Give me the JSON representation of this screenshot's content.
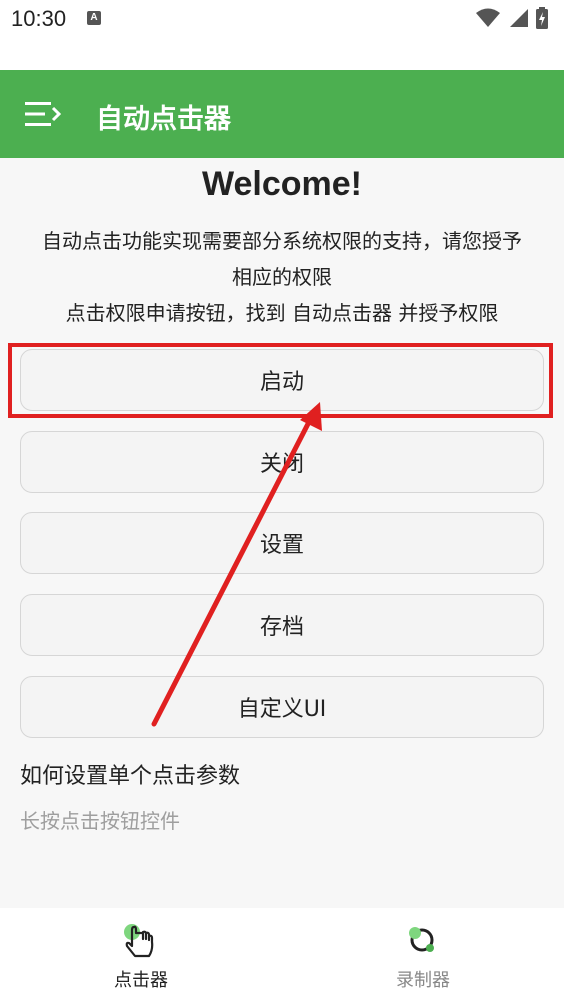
{
  "status_bar": {
    "time": "10:30",
    "notification_icon": "A"
  },
  "app_bar": {
    "title": "自动点击器",
    "menu_icon": "menu-icon"
  },
  "welcome": {
    "heading": "Welcome!",
    "line1": "自动点击功能实现需要部分系统权限的支持，请您授予",
    "line2": "相应的权限",
    "line3": "点击权限申请按钮，找到 自动点击器 并授予权限"
  },
  "buttons": {
    "start": "启动",
    "close": "关闭",
    "settings": "设置",
    "archive": "存档",
    "custom_ui": "自定义UI"
  },
  "howto": {
    "title": "如何设置单个点击参数",
    "subtitle": "长按点击按钮控件"
  },
  "bottom_nav": {
    "items": [
      {
        "label": "点击器",
        "active": true,
        "icon": "tap-hand-icon"
      },
      {
        "label": "录制器",
        "active": false,
        "icon": "record-icon"
      }
    ]
  },
  "colors": {
    "accent": "#4caf50",
    "highlight": "#e02020",
    "active_nav_text": "#222222",
    "inactive_nav_text": "#888888"
  }
}
